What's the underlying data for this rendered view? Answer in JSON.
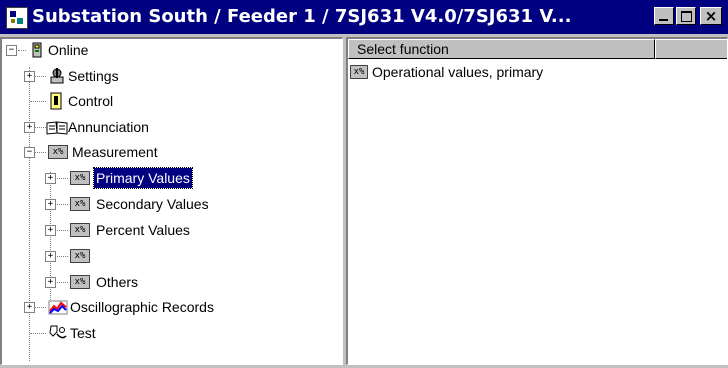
{
  "window": {
    "title": "Substation South / Feeder 1 / 7SJ631 V4.0/7SJ631 V...",
    "colors": {
      "titlebar": "#000080",
      "face": "#c0c0c0",
      "selection": "#000080"
    }
  },
  "tree": {
    "root": {
      "label": "Online",
      "expander": "−",
      "icon": "device-icon"
    },
    "items": [
      {
        "label": "Settings",
        "expander": "+",
        "icon": "settings-icon"
      },
      {
        "label": "Control",
        "expander": "",
        "icon": "control-icon"
      },
      {
        "label": "Annunciation",
        "expander": "+",
        "icon": "annunciation-icon"
      },
      {
        "label": "Measurement",
        "expander": "−",
        "icon": "measurement-icon"
      }
    ],
    "measurement_children": [
      {
        "label": "Primary Values",
        "expander": "+",
        "selected": true
      },
      {
        "label": "Secondary Values",
        "expander": "+"
      },
      {
        "label": "Percent Values",
        "expander": "+"
      },
      {
        "label": "",
        "expander": "+"
      },
      {
        "label": "Others",
        "expander": "+"
      }
    ],
    "after": [
      {
        "label": "Oscillographic Records",
        "expander": "+",
        "icon": "oscillograph-icon"
      },
      {
        "label": "Test",
        "expander": "",
        "icon": "test-icon"
      }
    ]
  },
  "list": {
    "column_header": "Select function",
    "rows": [
      {
        "label": "Operational values, primary",
        "icon": "measurement-icon"
      }
    ]
  }
}
